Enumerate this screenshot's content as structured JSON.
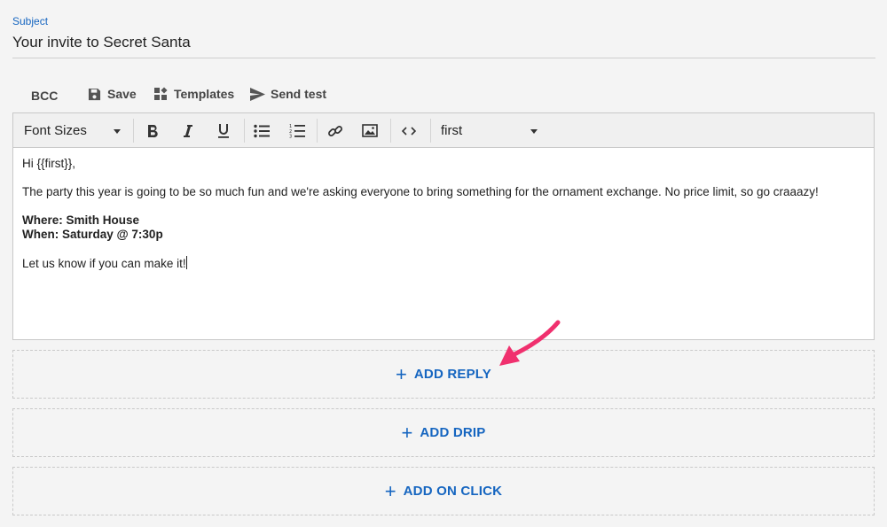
{
  "subject": {
    "label": "Subject",
    "value": "Your invite to Secret Santa"
  },
  "actions": {
    "bcc": "BCC",
    "save": "Save",
    "templates": "Templates",
    "send_test": "Send test"
  },
  "toolbar": {
    "font_sizes": "Font Sizes",
    "merge_field": "first"
  },
  "body": {
    "greeting": "Hi {{first}},",
    "paragraph": "The party this year is going to be so much fun and we're asking everyone to bring something for the ornament exchange. No price limit, so go craaazy!",
    "where": "Where: Smith House",
    "when": "When: Saturday @ 7:30p",
    "closing": "Let us know if you can make it!"
  },
  "add_buttons": {
    "reply": "ADD REPLY",
    "drip": "ADD DRIP",
    "on_click": "ADD ON CLICK"
  },
  "colors": {
    "accent": "#1565c0",
    "annotation_arrow": "#f0306e"
  }
}
